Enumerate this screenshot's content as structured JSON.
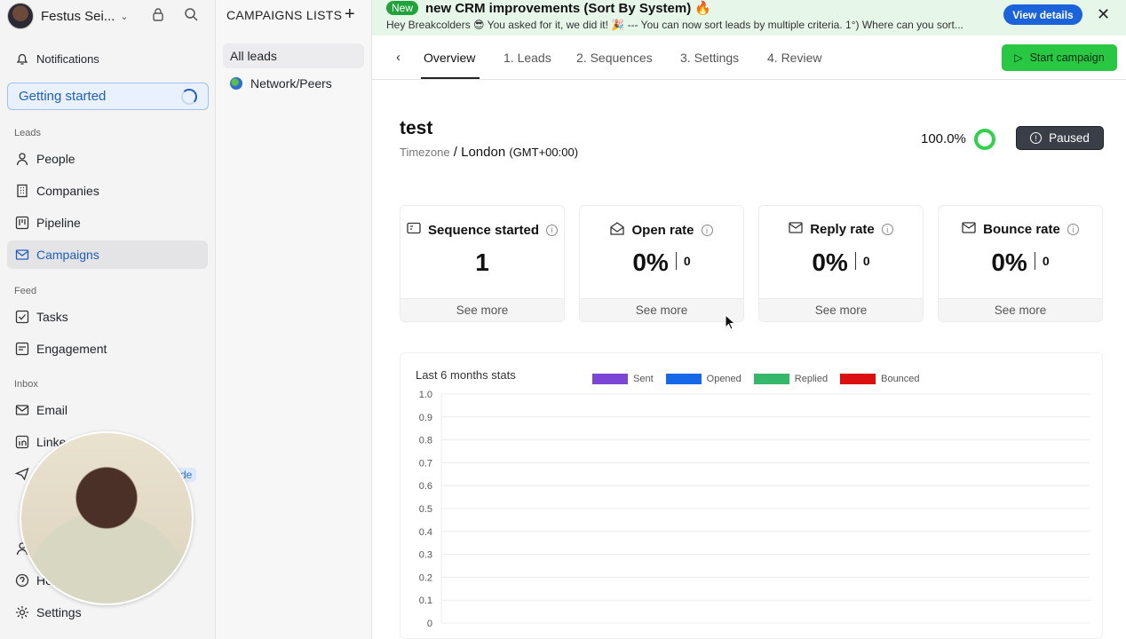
{
  "sidebar": {
    "user_name": "Festus Sei...",
    "notifications": "Notifications",
    "getting_started": "Getting started",
    "section_leads": "Leads",
    "people": "People",
    "companies": "Companies",
    "pipeline": "Pipeline",
    "campaigns": "Campaigns",
    "section_feed": "Feed",
    "tasks": "Tasks",
    "engagement": "Engagement",
    "section_inbox": "Inbox",
    "email": "Email",
    "linkedin": "Linke",
    "badge": "de",
    "help": "He",
    "settings": "Settings"
  },
  "lists": {
    "title": "CAMPAIGNS LISTS",
    "items": [
      "All leads",
      "Network/Peers"
    ]
  },
  "banner": {
    "badge": "New",
    "title": "new CRM improvements (Sort By System) 🔥",
    "text": "Hey Breakcolders 😎 You asked for it, we did it! 🎉 --- You can now sort leads by multiple criteria. 1°) Where can you sort...",
    "button": "View details"
  },
  "tabs": {
    "items": [
      "Overview",
      "1. Leads",
      "2. Sequences",
      "3. Settings",
      "4. Review"
    ],
    "start_campaign": "Start campaign"
  },
  "campaign": {
    "name": "test",
    "timezone_label": "Timezone",
    "timezone_city": "London",
    "timezone_gmt": "(GMT+00:00)",
    "progress": "100.0%",
    "status": "Paused"
  },
  "stats": [
    {
      "label": "Sequence started",
      "value": "1",
      "count": "",
      "footer": "See more",
      "icon": "sequence-icon"
    },
    {
      "label": "Open rate",
      "value": "0%",
      "count": "0",
      "footer": "See more",
      "icon": "open-mail-icon"
    },
    {
      "label": "Reply rate",
      "value": "0%",
      "count": "0",
      "footer": "See more",
      "icon": "reply-mail-icon"
    },
    {
      "label": "Bounce rate",
      "value": "0%",
      "count": "0",
      "footer": "See more",
      "icon": "bounce-mail-icon"
    }
  ],
  "chart_data": {
    "type": "bar",
    "title": "Last 6 months stats",
    "series": [
      {
        "name": "Sent",
        "color": "#7b45d6",
        "values": []
      },
      {
        "name": "Opened",
        "color": "#1668e8",
        "values": []
      },
      {
        "name": "Replied",
        "color": "#35b86a",
        "values": []
      },
      {
        "name": "Bounced",
        "color": "#dc0f10",
        "values": []
      }
    ],
    "ylim": [
      0,
      1.0
    ],
    "yticks": [
      "1.0",
      "0.9",
      "0.8",
      "0.7",
      "0.6",
      "0.5",
      "0.4",
      "0.3",
      "0.2",
      "0.1",
      "0"
    ],
    "grid": true,
    "legend": "top"
  }
}
